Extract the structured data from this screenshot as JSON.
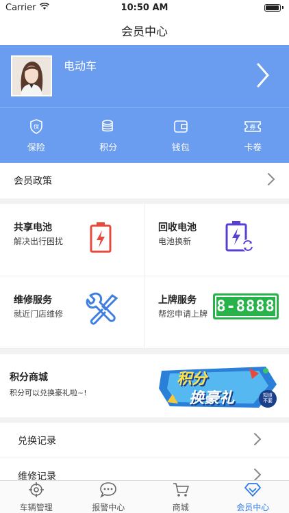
{
  "status_bar": {
    "carrier": "Carrier",
    "time": "10:50 AM",
    "battery_level": 0.95
  },
  "nav": {
    "title": "会员中心"
  },
  "profile": {
    "username": "电动车"
  },
  "quick_actions": [
    {
      "label": "保险",
      "icon": "insurance-shield-icon"
    },
    {
      "label": "积分",
      "icon": "coins-stack-icon"
    },
    {
      "label": "钱包",
      "icon": "wallet-icon"
    },
    {
      "label": "卡卷",
      "icon": "coupon-ticket-icon"
    }
  ],
  "policy": {
    "label": "会员政策"
  },
  "services": [
    {
      "title": "共享电池",
      "subtitle": "解决出行困扰",
      "icon": "battery-charge-icon"
    },
    {
      "title": "回收电池",
      "subtitle": "电池换新",
      "icon": "battery-recycle-icon"
    },
    {
      "title": "维修服务",
      "subtitle": "就近门店维修",
      "icon": "repair-tools-icon"
    },
    {
      "title": "上牌服务",
      "subtitle": "帮您申请上牌",
      "icon": "license-plate-icon",
      "plate_text": "8-8888"
    }
  ],
  "mall": {
    "title": "积分商城",
    "subtitle": "积分可以兑换豪礼啦~!",
    "banner_line1": "积分",
    "banner_line2": "换豪礼",
    "banner_badge": "知道\n不要"
  },
  "records": [
    {
      "label": "兑换记录"
    },
    {
      "label": "维修记录"
    }
  ],
  "tabs": [
    {
      "label": "车辆管理",
      "icon": "crosshair-target-icon",
      "active": false
    },
    {
      "label": "报警中心",
      "icon": "chat-bubble-icon",
      "active": false
    },
    {
      "label": "商城",
      "icon": "shopping-cart-icon",
      "active": false
    },
    {
      "label": "会员中心",
      "icon": "member-diamond-icon",
      "active": true
    }
  ],
  "colors": {
    "brand_blue": "#6a9cf0",
    "active_tab": "#2f79e8",
    "red": "#e64a3b",
    "purple": "#5a3fd1",
    "plate_green": "#27b34a"
  }
}
